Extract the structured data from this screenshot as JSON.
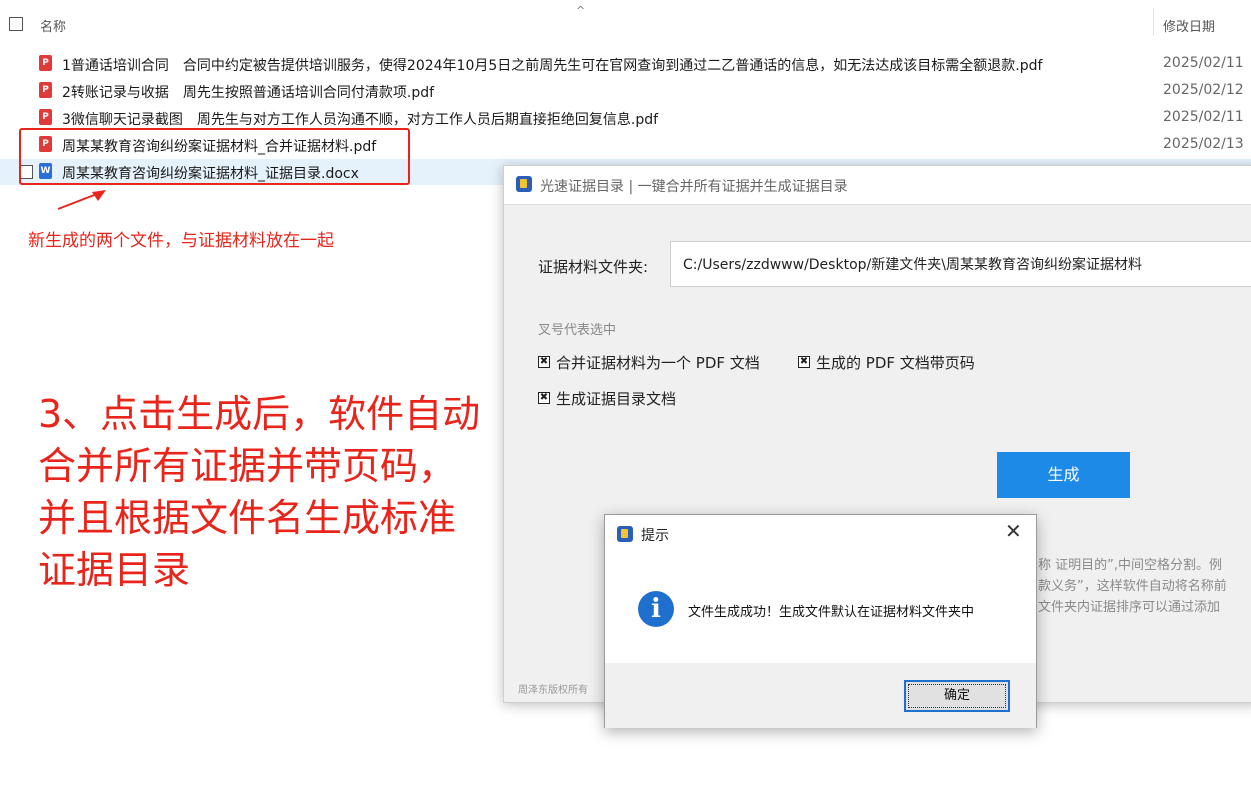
{
  "explorer": {
    "header_name": "名称",
    "header_date": "修改日期",
    "sort_indicator": "^",
    "files": [
      {
        "name": "1普通话培训合同　合同中约定被告提供培训服务，使得2024年10月5日之前周先生可在官网查询到通过二乙普通话的信息，如无法达成该目标需全额退款.pdf",
        "date": "2025/02/11",
        "type": "pdf"
      },
      {
        "name": "2转账记录与收据　周先生按照普通话培训合同付清款项.pdf",
        "date": "2025/02/12",
        "type": "pdf"
      },
      {
        "name": "3微信聊天记录截图　周先生与对方工作人员沟通不顺，对方工作人员后期直接拒绝回复信息.pdf",
        "date": "2025/02/11",
        "type": "pdf"
      },
      {
        "name": "周某某教育咨询纠纷案证据材料_合并证据材料.pdf",
        "date": "2025/02/13",
        "type": "pdf"
      },
      {
        "name": "周某某教育咨询纠纷案证据材料_证据目录.docx",
        "date": "",
        "type": "docx"
      }
    ],
    "icon_pdf_glyph": "P",
    "icon_doc_glyph": "W"
  },
  "annotations": {
    "small_note": "新生成的两个文件，与证据材料放在一起",
    "big_note_lines": [
      "3、点击生成后，软件自动",
      "合并所有证据并带页码，",
      "并且根据文件名生成标准",
      "证据目录"
    ],
    "accent_color": "#e8241b"
  },
  "app": {
    "title": "光速证据目录 | 一键合并所有证据并生成证据目录",
    "folder_label": "证据材料文件夹:",
    "folder_value": "C:/Users/zzdwww/Desktop/新建文件夹\\周某某教育咨询纠纷案证据材料",
    "hint_label": "叉号代表选中",
    "options": [
      {
        "label": "合并证据材料为一个 PDF 文档",
        "checked": true
      },
      {
        "label": "生成的 PDF 文档带页码",
        "checked": true
      },
      {
        "label": "生成证据目录文档",
        "checked": true
      }
    ],
    "check_mark": "✖",
    "generate_label": "生成",
    "bg_lines": [
      "称 证明目的”,中间空格分割。例",
      "款义务”，这样软件自动将名称前",
      "文件夹内证据排序可以通过添加"
    ],
    "copyright": "周泽东版权所有",
    "accent_color": "#1e8ae8"
  },
  "dialog": {
    "title": "提示",
    "close_glyph": "✕",
    "info_glyph": "i",
    "message": "文件生成成功！生成文件默认在证据材料文件夹中",
    "ok_label": "确定"
  }
}
